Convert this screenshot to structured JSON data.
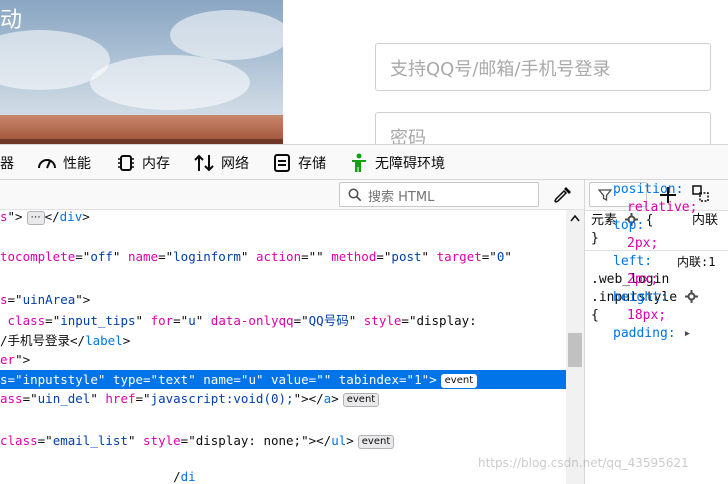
{
  "page": {
    "hero_text": "动",
    "username_placeholder": "支持QQ号/邮箱/手机号登录",
    "password_placeholder": "密码"
  },
  "devtools": {
    "tabs": [
      {
        "label": "器",
        "icon": "inspector-icon"
      },
      {
        "label": "性能",
        "icon": "performance-icon"
      },
      {
        "label": "内存",
        "icon": "memory-icon"
      },
      {
        "label": "网络",
        "icon": "network-icon"
      },
      {
        "label": "存储",
        "icon": "storage-icon"
      },
      {
        "label": "无障碍环境",
        "icon": "accessibility-icon"
      }
    ],
    "search_placeholder": "搜索 HTML",
    "markup_lines": [
      {
        "parts": [
          [
            "an",
            "s"
          ],
          [
            "t",
            "\">"
          ],
          [
            "b",
            "⋯"
          ],
          [
            "t",
            "</"
          ],
          [
            "tg",
            "div"
          ],
          [
            "t",
            ">"
          ]
        ]
      },
      {
        "parts": []
      },
      {
        "parts": [
          [
            "an",
            "tocomplete"
          ],
          [
            "t",
            "=\""
          ],
          [
            "av",
            "off"
          ],
          [
            "t",
            "\" "
          ],
          [
            "an",
            "name"
          ],
          [
            "t",
            "=\""
          ],
          [
            "av",
            "loginform"
          ],
          [
            "t",
            "\" "
          ],
          [
            "an",
            "action"
          ],
          [
            "t",
            "=\"\" "
          ],
          [
            "an",
            "method"
          ],
          [
            "t",
            "=\""
          ],
          [
            "av",
            "post"
          ],
          [
            "t",
            "\" "
          ],
          [
            "an",
            "target"
          ],
          [
            "t",
            "=\""
          ],
          [
            "av",
            "0"
          ],
          [
            "t",
            "\""
          ]
        ]
      },
      {
        "parts": []
      },
      {
        "parts": [
          [
            "an",
            "s"
          ],
          [
            "t",
            "=\""
          ],
          [
            "av",
            "uinArea"
          ],
          [
            "t",
            "\">"
          ]
        ]
      },
      {
        "parts": [
          [
            "t",
            " "
          ],
          [
            "an",
            "class"
          ],
          [
            "t",
            "=\""
          ],
          [
            "av",
            "input_tips"
          ],
          [
            "t",
            "\" "
          ],
          [
            "an",
            "for"
          ],
          [
            "t",
            "=\""
          ],
          [
            "av",
            "u"
          ],
          [
            "t",
            "\" "
          ],
          [
            "an",
            "data-onlyqq"
          ],
          [
            "t",
            "=\""
          ],
          [
            "av",
            "QQ号码"
          ],
          [
            "t",
            "\" "
          ],
          [
            "an",
            "style"
          ],
          [
            "t",
            "=\"display:"
          ]
        ]
      },
      {
        "parts": [
          [
            "t",
            "/手机号登录</"
          ],
          [
            "tg",
            "label"
          ],
          [
            "t",
            ">"
          ]
        ]
      },
      {
        "parts": [
          [
            "an",
            "er"
          ],
          [
            "t",
            "\">"
          ]
        ]
      },
      {
        "selected": true,
        "parts": [
          [
            "an",
            "s"
          ],
          [
            "t",
            "=\""
          ],
          [
            "av",
            "inputstyle"
          ],
          [
            "t",
            "\" "
          ],
          [
            "an",
            "type"
          ],
          [
            "t",
            "=\""
          ],
          [
            "av",
            "text"
          ],
          [
            "t",
            "\" "
          ],
          [
            "an",
            "name"
          ],
          [
            "t",
            "=\""
          ],
          [
            "av",
            "u"
          ],
          [
            "t",
            "\" "
          ],
          [
            "an",
            "value"
          ],
          [
            "t",
            "=\"\" "
          ],
          [
            "an",
            "tabindex"
          ],
          [
            "t",
            "=\""
          ],
          [
            "av",
            "1"
          ],
          [
            "t",
            "\">"
          ],
          [
            "e",
            "event"
          ]
        ]
      },
      {
        "parts": [
          [
            "an",
            "ass"
          ],
          [
            "t",
            "=\""
          ],
          [
            "av",
            "uin_del"
          ],
          [
            "t",
            "\" "
          ],
          [
            "an",
            "href"
          ],
          [
            "t",
            "=\""
          ],
          [
            "av",
            "javascript:void(0);"
          ],
          [
            "t",
            "\"></"
          ],
          [
            "tg",
            "a"
          ],
          [
            "t",
            ">"
          ],
          [
            "e",
            "event"
          ]
        ]
      },
      {
        "parts": []
      },
      {
        "parts": [
          [
            "an",
            "class"
          ],
          [
            "t",
            "=\""
          ],
          [
            "av",
            "email_list"
          ],
          [
            "t",
            "\" "
          ],
          [
            "an",
            "style"
          ],
          [
            "t",
            "=\"display: none;\"></"
          ],
          [
            "tg",
            "ul"
          ],
          [
            "t",
            ">"
          ],
          [
            "e",
            "event"
          ]
        ]
      },
      {
        "parts": []
      },
      {
        "parts": [
          [
            "t",
            "                       /"
          ],
          [
            "tg",
            "di"
          ]
        ]
      }
    ]
  },
  "rules": {
    "element_label": "元素",
    "inline_label": "内联",
    "brace_open": "{",
    "brace_close": "}",
    "source": "内联:1",
    "selector_1": ".web_login",
    "selector_2": ".inputstyle",
    "declarations": [
      {
        "prop": "width:",
        "value": "258px;"
      },
      {
        "prop": "position:",
        "value": "relative;"
      },
      {
        "prop": "top:",
        "value": "2px;"
      },
      {
        "prop": "left:",
        "value": "2px;"
      },
      {
        "prop": "height:",
        "value": "18px;"
      },
      {
        "prop": "padding:",
        "value": ""
      }
    ]
  },
  "watermark": "https://blog.csdn.net/qq_43595621",
  "colors": {
    "selection": "#0074e8",
    "attr_name": "#dd00a9",
    "attr_value": "#003eaa"
  }
}
